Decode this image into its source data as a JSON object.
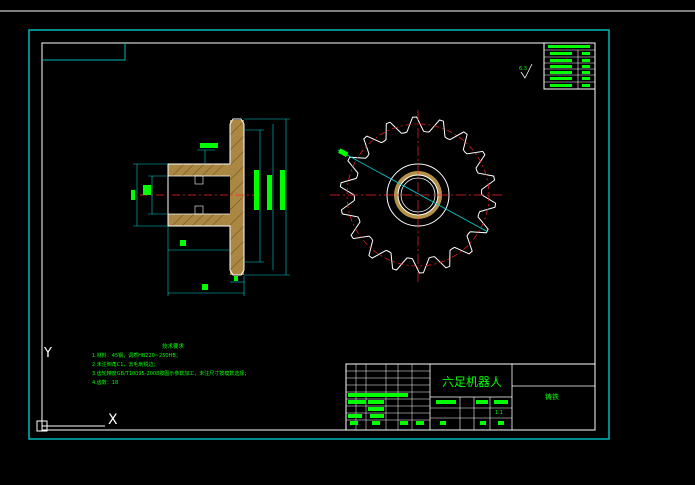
{
  "drawing": {
    "title": "六足机器人",
    "material_label": "铸铁",
    "tech_title": "技术要求",
    "tech_notes": [
      "1.材料：45钢，调质HB220~250HB；",
      "2.未注倒角C1，去毛刺锐边；",
      "3.齿轮精度GB/T10095-2008按图示参数加工，未注尺寸按模数选择；",
      "4.齿数：18"
    ],
    "scale": "1:1",
    "sheet": "1:1",
    "roughness": "6.3",
    "ucs_y": "Y",
    "ucs_x": "X"
  },
  "colors": {
    "background": "#000000",
    "frame": "#00b8b8",
    "border": "#ffffff",
    "text": "#00ff00",
    "hatch": "#c8a050",
    "center": "#ff2020",
    "dimension": "#00d0d0"
  }
}
